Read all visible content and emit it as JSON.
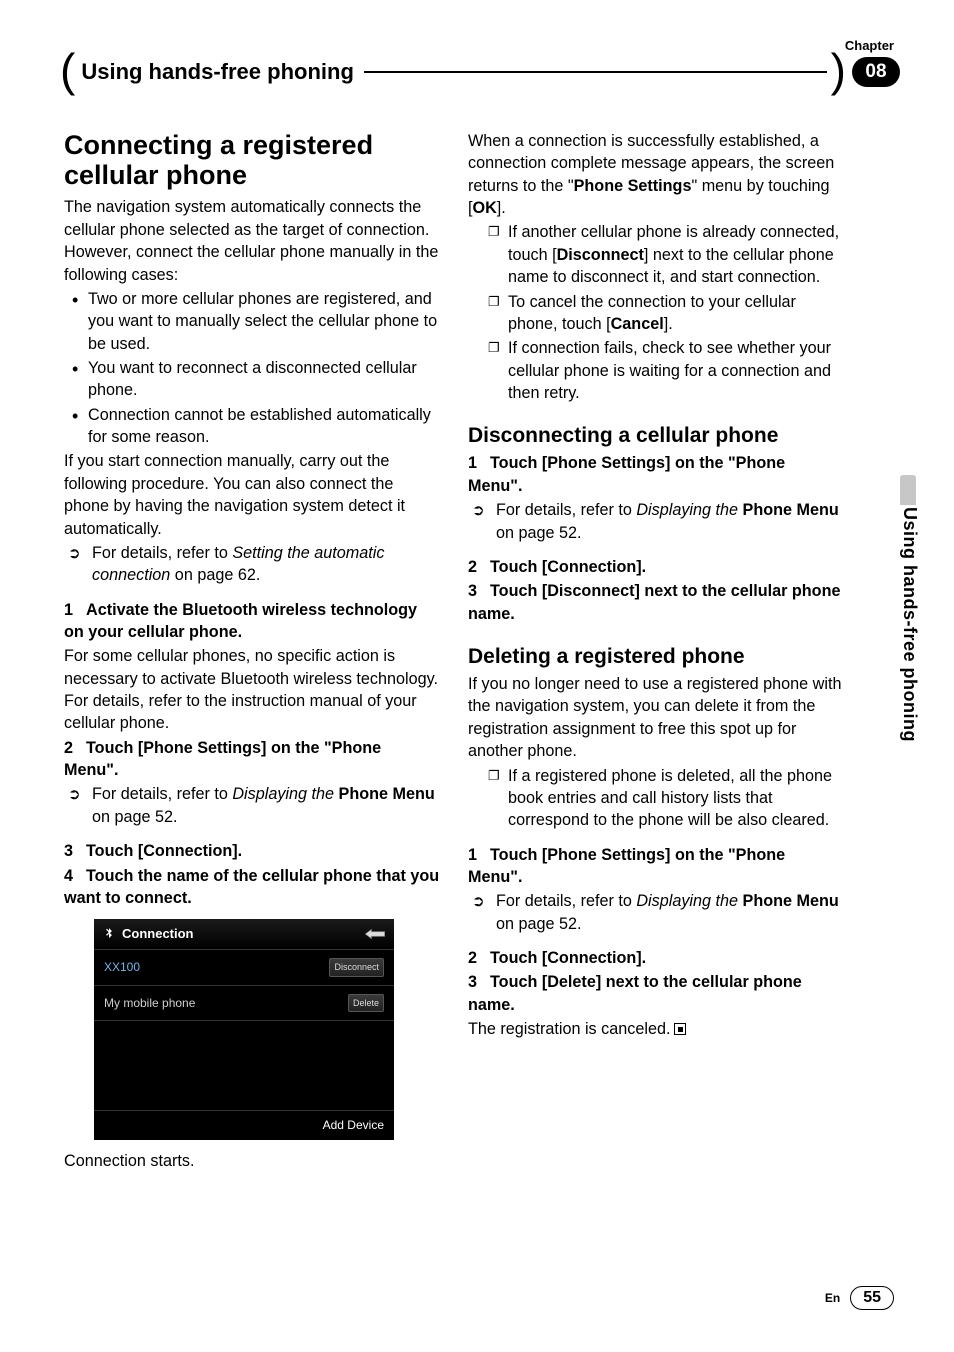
{
  "chapter": {
    "label": "Chapter",
    "number": "08"
  },
  "header_title": "Using hands-free phoning",
  "side_tab": "Using hands-free phoning",
  "footer": {
    "lang": "En",
    "page": "55"
  },
  "section1": {
    "title": "Connecting a registered cellular phone",
    "intro": "The navigation system automatically connects the cellular phone selected as the target of connection. However, connect the cellular phone manually in the following cases:",
    "cases": [
      "Two or more cellular phones are registered, and you want to manually select the cellular phone to be used.",
      "You want to reconnect a disconnected cellular phone.",
      "Connection cannot be established automatically for some reason."
    ],
    "after_cases": "If you start connection manually, carry out the following procedure. You can also connect the phone by having the navigation system detect it automatically.",
    "ptr1_a": "For details, refer to ",
    "ptr1_b": "Setting the automatic connection",
    "ptr1_c": " on page 62.",
    "step1_hd": "Activate the Bluetooth wireless technology on your cellular phone.",
    "step1_body": "For some cellular phones, no specific action is necessary to activate Bluetooth wireless technology. For details, refer to the instruction manual of your cellular phone.",
    "step2_hd": "Touch [Phone Settings] on the \"Phone Menu\".",
    "step2_ptr_a": "For details, refer to ",
    "step2_ptr_b": "Displaying the",
    "step2_ptr_c": "Phone Menu",
    "step2_ptr_d": " on page 52.",
    "step3_hd": "Touch [Connection].",
    "step4_hd": "Touch the name of the cellular phone that you want to connect.",
    "after_shot": "Connection starts."
  },
  "screenshot": {
    "title": "Connection",
    "row1_name": "XX100",
    "row1_btn": "Disconnect",
    "row2_name": "My mobile phone",
    "row2_btn": "Delete",
    "bottom": "Add Device"
  },
  "col2_top": {
    "p1_a": "When a connection is successfully established, a connection complete message appears, the screen returns to the \"",
    "p1_b": "Phone Settings",
    "p1_c": "\" menu by touching [",
    "p1_d": "OK",
    "p1_e": "].",
    "note1_a": "If another cellular phone is already connected, touch [",
    "note1_b": "Disconnect",
    "note1_c": "] next to the cellular phone name to disconnect it, and start connection.",
    "note2_a": "To cancel the connection to your cellular phone, touch [",
    "note2_b": "Cancel",
    "note2_c": "].",
    "note3": "If connection fails, check to see whether your cellular phone is waiting for a connection and then retry."
  },
  "section2": {
    "title": "Disconnecting a cellular phone",
    "step1_hd": "Touch [Phone Settings] on the \"Phone Menu\".",
    "ptr_a": "For details, refer to ",
    "ptr_b": "Displaying the",
    "ptr_c": "Phone Menu",
    "ptr_d": " on page 52.",
    "step2_hd": "Touch [Connection].",
    "step3_hd": "Touch [Disconnect] next to the cellular phone name."
  },
  "section3": {
    "title": "Deleting a registered phone",
    "intro": "If you no longer need to use a registered phone with the navigation system, you can delete it from the registration assignment to free this spot up for another phone.",
    "note1": "If a registered phone is deleted, all the phone book entries and call history lists that correspond to the phone will be also cleared.",
    "step1_hd": "Touch [Phone Settings] on the \"Phone Menu\".",
    "ptr_a": "For details, refer to ",
    "ptr_b": "Displaying the",
    "ptr_c": "Phone Menu",
    "ptr_d": " on page 52.",
    "step2_hd": "Touch [Connection].",
    "step3_hd": "Touch [Delete] next to the cellular phone name.",
    "closing": "The registration is canceled."
  }
}
